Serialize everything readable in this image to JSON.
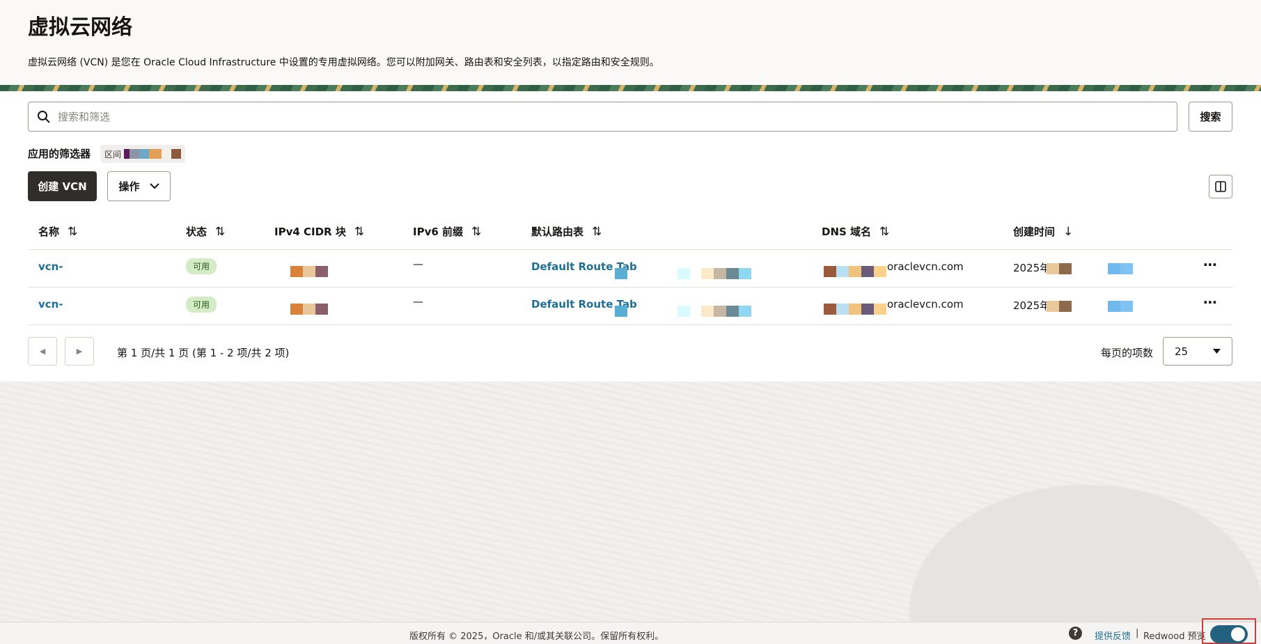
{
  "page": {
    "title": "虚拟云网络",
    "description": "虚拟云网络 (VCN) 是您在 Oracle Cloud Infrastructure 中设置的专用虚拟网络。您可以附加网关、路由表和安全列表，以指定路由和安全规则。"
  },
  "search": {
    "placeholder": "搜索和筛选",
    "button_label": "搜索"
  },
  "filters": {
    "label": "应用的筛选器",
    "chip_text": "区间"
  },
  "toolbar": {
    "create_label": "创建 VCN",
    "actions_label": "操作"
  },
  "table": {
    "columns": [
      "名称",
      "状态",
      "IPv4 CIDR 块",
      "IPv6 前缀",
      "默认路由表",
      "DNS 域名",
      "创建时间"
    ],
    "rows": [
      {
        "name": "vcn-",
        "status": "可用",
        "ipv6": "—",
        "route_table": "Default Route Tab",
        "dns": "oraclevcn.com",
        "created": "2025年"
      },
      {
        "name": "vcn-",
        "status": "可用",
        "ipv6": "—",
        "route_table": "Default Route Tab",
        "dns": "oraclevcn.com",
        "created": "2025年"
      }
    ]
  },
  "pagination": {
    "summary": "第 1 页/共 1 页 (第 1 - 2 项/共 2 项)",
    "per_page_label": "每页的项数",
    "per_page_value": "25"
  },
  "footer": {
    "copyright": "版权所有 © 2025，Oracle 和/或其关联公司。保留所有权利。",
    "feedback": "提供反馈",
    "separator": "|",
    "redwood": "Redwood 预览",
    "help": "?"
  },
  "colors": {
    "primary_button": "#312d2a",
    "link": "#1f6f95",
    "status_badge_bg": "#d4ecc5",
    "toggle_on": "#22627e"
  },
  "icons": [
    "search-icon",
    "chevron-down-icon",
    "columns-icon",
    "sort-icon",
    "sort-down-icon",
    "more-icon",
    "chevron-left-icon",
    "chevron-right-icon",
    "caret-down-icon",
    "help-icon"
  ]
}
